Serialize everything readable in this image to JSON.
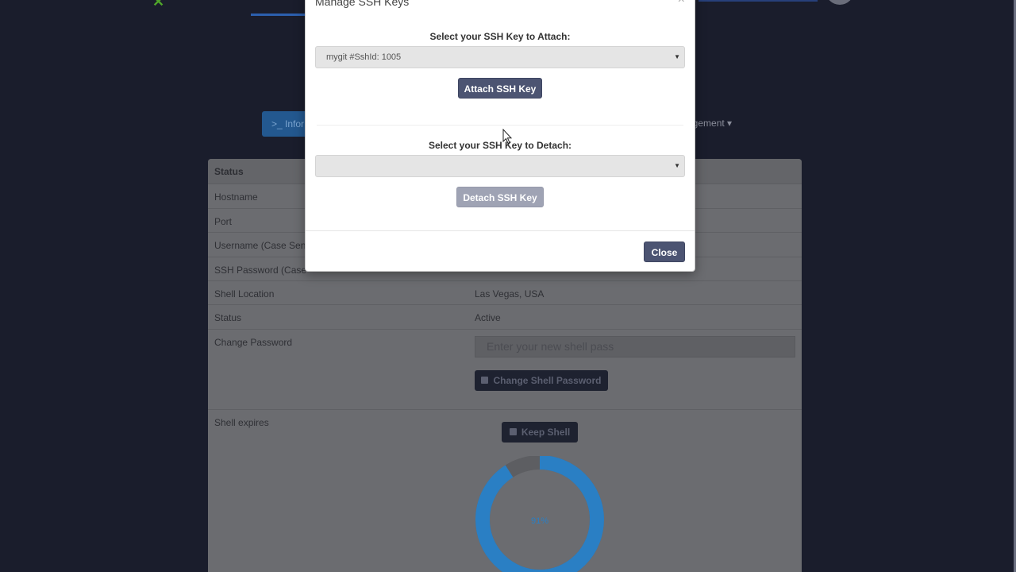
{
  "background": {
    "tabs": {
      "info_label": ">_ Infor",
      "management_label": "agement ▾"
    },
    "panel": {
      "header": "Status",
      "rows": [
        {
          "label": "Hostname",
          "value": ""
        },
        {
          "label": "Port",
          "value": ""
        },
        {
          "label": "Username (Case Sens",
          "value": ""
        },
        {
          "label": "SSH Password (Case",
          "value": ""
        },
        {
          "label": "Shell Location",
          "value": "Las Vegas, USA"
        },
        {
          "label": "Status",
          "value": "Active"
        }
      ],
      "change_password": {
        "label": "Change Password",
        "placeholder": "Enter your new shell pass",
        "button": "Change Shell Password"
      },
      "shell_expires": {
        "label": "Shell expires",
        "button": "Keep Shell",
        "percent_text": "91%",
        "percent": 91
      }
    }
  },
  "modal": {
    "title": "Manage SSH Keys",
    "close_glyph": "×",
    "attach": {
      "label": "Select your SSH Key to Attach:",
      "selected": "mygit #SshId: 1005",
      "button": "Attach SSH Key"
    },
    "detach": {
      "label": "Select your SSH Key to Detach:",
      "selected": "",
      "button": "Detach SSH Key"
    },
    "close_button": "Close"
  },
  "colors": {
    "accent": "#4c5472",
    "donut": "#2a7fc4",
    "background": "#1a1d2c"
  }
}
